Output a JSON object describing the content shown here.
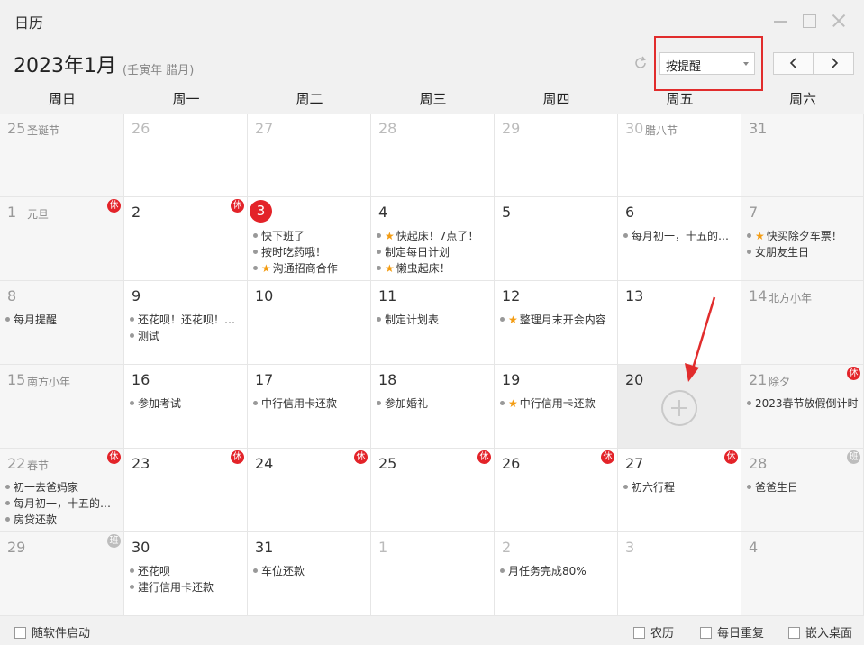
{
  "window": {
    "title": "日历"
  },
  "header": {
    "month_title": "2023年1月",
    "lunar_year": "(壬寅年 腊月)",
    "mode_select": {
      "value": "按提醒"
    }
  },
  "weekdays": [
    "周日",
    "周一",
    "周二",
    "周三",
    "周四",
    "周五",
    "周六"
  ],
  "calendar": {
    "weeks": [
      [
        {
          "day": "25",
          "lunar": "圣诞节",
          "other": true,
          "weekend": true,
          "events": []
        },
        {
          "day": "26",
          "other": true,
          "events": []
        },
        {
          "day": "27",
          "other": true,
          "events": []
        },
        {
          "day": "28",
          "other": true,
          "events": []
        },
        {
          "day": "29",
          "other": true,
          "events": []
        },
        {
          "day": "30",
          "lunar": "腊八节",
          "other": true,
          "events": []
        },
        {
          "day": "31",
          "other": true,
          "weekend": true,
          "events": []
        }
      ],
      [
        {
          "day": "1",
          "lunar": "元旦",
          "weekend": true,
          "badge": "休",
          "badge_type": "rest",
          "events": []
        },
        {
          "day": "2",
          "badge": "休",
          "badge_type": "rest",
          "events": []
        },
        {
          "day": "3",
          "today": true,
          "events": [
            {
              "text": "快下班了"
            },
            {
              "text": "按时吃药哦！"
            },
            {
              "text": "沟通招商合作",
              "star": true
            }
          ]
        },
        {
          "day": "4",
          "events": [
            {
              "text": "快起床！7点了！",
              "star": true
            },
            {
              "text": "制定每日计划"
            },
            {
              "text": "懒虫起床！",
              "star": true
            }
          ]
        },
        {
          "day": "5",
          "events": []
        },
        {
          "day": "6",
          "events": [
            {
              "text": "每月初一，十五的…"
            }
          ]
        },
        {
          "day": "7",
          "weekend": true,
          "events": [
            {
              "text": "快买除夕车票！",
              "star": true
            },
            {
              "text": "女朋友生日"
            }
          ]
        }
      ],
      [
        {
          "day": "8",
          "weekend": true,
          "events": [
            {
              "text": "每月提醒"
            }
          ]
        },
        {
          "day": "9",
          "events": [
            {
              "text": "还花呗！还花呗！…"
            },
            {
              "text": "测试"
            }
          ]
        },
        {
          "day": "10",
          "events": []
        },
        {
          "day": "11",
          "events": [
            {
              "text": "制定计划表"
            }
          ]
        },
        {
          "day": "12",
          "events": [
            {
              "text": "整理月末开会内容",
              "star": true
            }
          ]
        },
        {
          "day": "13",
          "events": []
        },
        {
          "day": "14",
          "lunar": "北方小年",
          "weekend": true,
          "events": []
        }
      ],
      [
        {
          "day": "15",
          "lunar": "南方小年",
          "weekend": true,
          "events": []
        },
        {
          "day": "16",
          "events": [
            {
              "text": "参加考试"
            }
          ]
        },
        {
          "day": "17",
          "events": [
            {
              "text": "中行信用卡还款"
            }
          ]
        },
        {
          "day": "18",
          "events": [
            {
              "text": "参加婚礼"
            }
          ]
        },
        {
          "day": "19",
          "events": [
            {
              "text": "中行信用卡还款",
              "star": true
            }
          ]
        },
        {
          "day": "20",
          "selected": true,
          "events": []
        },
        {
          "day": "21",
          "lunar": "除夕",
          "weekend": true,
          "badge": "休",
          "badge_type": "rest",
          "events": [
            {
              "text": "2023春节放假倒计时"
            }
          ]
        }
      ],
      [
        {
          "day": "22",
          "lunar": "春节",
          "weekend": true,
          "badge": "休",
          "badge_type": "rest",
          "events": [
            {
              "text": "初一去爸妈家"
            },
            {
              "text": "每月初一，十五的…"
            },
            {
              "text": "房贷还款"
            }
          ]
        },
        {
          "day": "23",
          "badge": "休",
          "badge_type": "rest",
          "events": []
        },
        {
          "day": "24",
          "badge": "休",
          "badge_type": "rest",
          "events": []
        },
        {
          "day": "25",
          "badge": "休",
          "badge_type": "rest",
          "events": []
        },
        {
          "day": "26",
          "badge": "休",
          "badge_type": "rest",
          "events": []
        },
        {
          "day": "27",
          "badge": "休",
          "badge_type": "rest",
          "events": [
            {
              "text": "初六行程"
            }
          ]
        },
        {
          "day": "28",
          "weekend": true,
          "badge": "班",
          "badge_type": "work",
          "events": [
            {
              "text": "爸爸生日"
            }
          ]
        }
      ],
      [
        {
          "day": "29",
          "weekend": true,
          "badge": "班",
          "badge_type": "work",
          "events": []
        },
        {
          "day": "30",
          "events": [
            {
              "text": "还花呗"
            },
            {
              "text": "建行信用卡还款"
            }
          ]
        },
        {
          "day": "31",
          "events": [
            {
              "text": "车位还款"
            }
          ]
        },
        {
          "day": "1",
          "other": true,
          "events": []
        },
        {
          "day": "2",
          "other": true,
          "events": [
            {
              "text": "月任务完成80%"
            }
          ]
        },
        {
          "day": "3",
          "other": true,
          "events": []
        },
        {
          "day": "4",
          "other": true,
          "weekend": true,
          "events": []
        }
      ]
    ]
  },
  "footer": {
    "autostart_label": "随软件启动",
    "lunar_label": "农历",
    "daily_repeat_label": "每日重复",
    "embed_desktop_label": "嵌入桌面"
  },
  "colors": {
    "accent_red": "#e32329",
    "highlight_box": "#e12c2c",
    "star": "#f39c12",
    "work_badge": "#bdbdbd"
  }
}
